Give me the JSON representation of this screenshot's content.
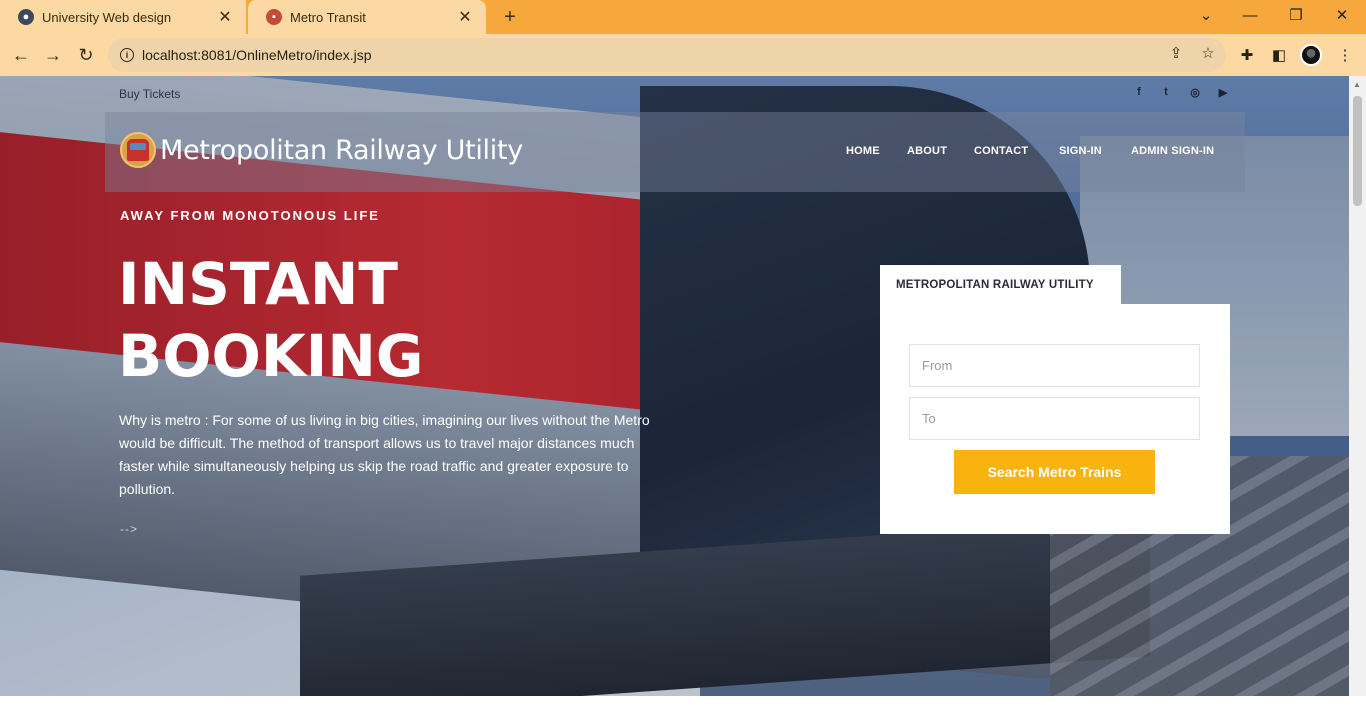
{
  "browser": {
    "tabs": [
      {
        "title": "University Web design",
        "icon": "globe-icon",
        "active": false
      },
      {
        "title": "Metro Transit",
        "icon": "train-icon",
        "active": true
      }
    ],
    "new_tab_label": "+",
    "url": "localhost:8081/OnlineMetro/index.jsp",
    "controls": {
      "back": "←",
      "forward": "→",
      "reload": "↻",
      "minimize": "—",
      "restore": "❐",
      "close": "✕",
      "tab_list": "⌄"
    }
  },
  "page": {
    "topbar": {
      "buy_tickets": "Buy Tickets"
    },
    "social": [
      {
        "name": "facebook-icon",
        "glyph": "f"
      },
      {
        "name": "twitter-icon",
        "glyph": "t"
      },
      {
        "name": "instagram-icon",
        "glyph": "◎"
      },
      {
        "name": "youtube-icon",
        "glyph": "▶"
      }
    ],
    "brand": {
      "name": "Metropolitan Railway Utility"
    },
    "nav": {
      "home": "HOME",
      "about": "ABOUT",
      "contact": "CONTACT",
      "signin": "SIGN-IN",
      "admin_signin": "ADMIN SIGN-IN"
    },
    "hero": {
      "kicker": "AWAY FROM MONOTONOUS LIFE",
      "headline_line1": "INSTANT",
      "headline_line2": "BOOKING",
      "description": "Why is metro : For some of us living in big cities, imagining our lives without the Metro would be difficult. The method of transport allows us to travel major distances much faster while simultaneously helping us skip the road traffic and greater exposure to pollution.",
      "more": "-->"
    },
    "booking": {
      "tab_label": "METROPOLITAN RAILWAY UTILITY",
      "from_placeholder": "From",
      "to_placeholder": "To",
      "search_label": "Search Metro Trains"
    }
  },
  "colors": {
    "tab_strip": "#f7a83c",
    "toolbar": "#fcd8a3",
    "accent_button": "#f8b30e",
    "train_red": "#d92b2f"
  }
}
